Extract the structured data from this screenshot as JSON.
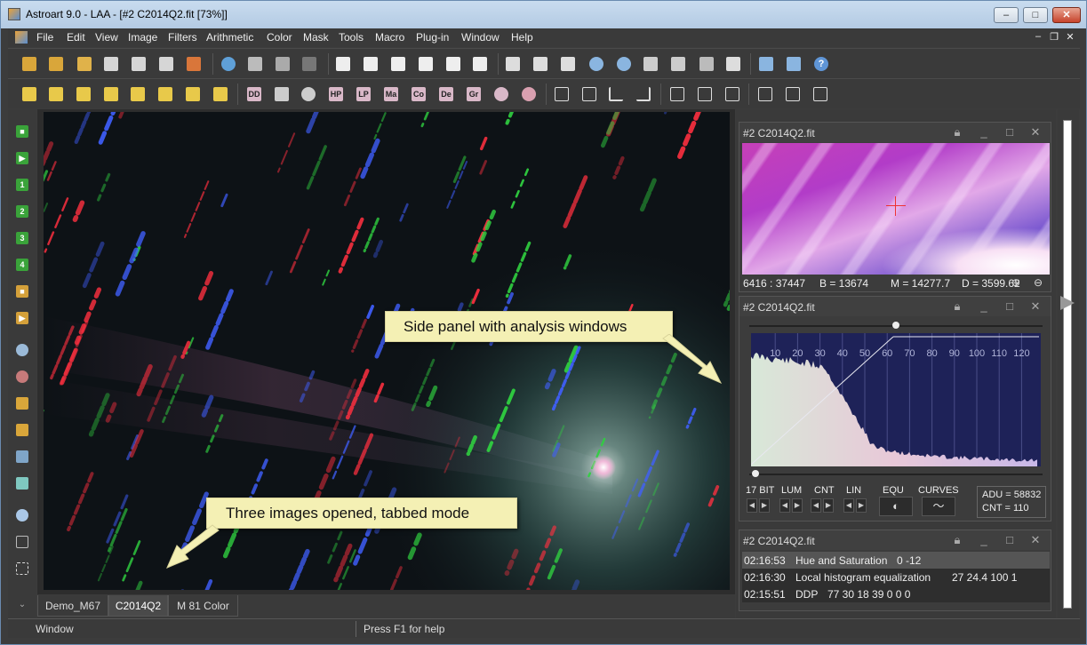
{
  "window": {
    "title": "Astroart 9.0 - LAA - [#2 C2014Q2.fit  [73%]]",
    "minimize": "–",
    "maximize": "□",
    "close": "✕"
  },
  "menu": {
    "items": [
      "File",
      "Edit",
      "View",
      "Image",
      "Filters",
      "Arithmetic",
      "Color",
      "Mask",
      "Tools",
      "Macro",
      "Plug-in",
      "Window",
      "Help"
    ],
    "mdi": {
      "minimize": "–",
      "restore": "❐",
      "close": "✕"
    }
  },
  "toolbar2_labels": [
    "DD",
    "HP",
    "LP",
    "Ma",
    "Co",
    "De",
    "Gr"
  ],
  "left_toolbar_labels": [
    "1",
    "2",
    "3",
    "4"
  ],
  "tabs": [
    {
      "label": "Demo_M67",
      "selected": false
    },
    {
      "label": "C2014Q2",
      "selected": true
    },
    {
      "label": "M 81 Color",
      "selected": false
    }
  ],
  "status": {
    "left": "Window",
    "help": "Press F1 for help"
  },
  "callouts": {
    "panel": "Side panel with analysis windows",
    "tabs": "Three images opened, tabbed mode"
  },
  "preview": {
    "title": "#2 C2014Q2.fit",
    "coords": "6416 : 37447",
    "b": "B = 13674",
    "m": "M = 14277.7",
    "d": "D = 3599.62"
  },
  "histogram": {
    "title": "#2 C2014Q2.fit",
    "ticks": [
      "10",
      "20",
      "30",
      "40",
      "50",
      "60",
      "70",
      "80",
      "90",
      "100",
      "110",
      "120"
    ],
    "modes": [
      "17 BIT",
      "LUM",
      "CNT",
      "LIN",
      "EQU",
      "CURVES"
    ],
    "adu": "ADU = 58832",
    "cnt": "CNT = 110"
  },
  "history": {
    "title": "#2 C2014Q2.fit",
    "rows": [
      {
        "time": "02:16:53",
        "op": "Hue and Saturation",
        "params": "0  -12"
      },
      {
        "time": "02:16:30",
        "op": "Local histogram equalization",
        "params": "27  24.4  100  1"
      },
      {
        "time": "02:15:51",
        "op": "DDP",
        "params": "77  30  18  39  0  0    0"
      }
    ]
  },
  "colors": {
    "bg": "#3c3c3c",
    "titlebar": "#b9cee5",
    "callout": "#f4f0b4",
    "green_tool": "#3aa33a",
    "yellow_tool": "#e8c94a"
  }
}
